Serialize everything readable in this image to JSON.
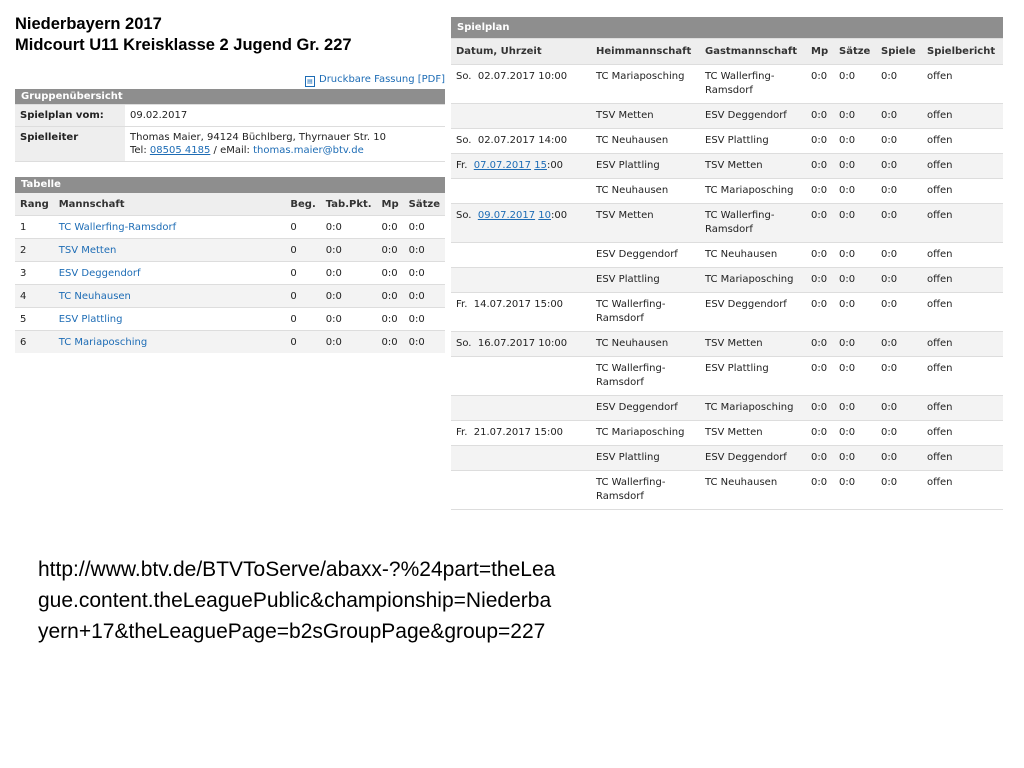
{
  "page": {
    "title_line1": "Niederbayern 2017",
    "title_line2": "Midcourt U11 Kreisklasse 2 Jugend Gr. 227",
    "print_link": "Druckbare Fassung [PDF]"
  },
  "group": {
    "header": "Gruppenübersicht",
    "spielplan_label": "Spielplan vom:",
    "spielplan_value": "09.02.2017",
    "leiter_label": "Spielleiter",
    "leiter_name": "Thomas Maier, 94124 Büchlberg, Thyrnauer Str. 10",
    "tel_label": "Tel: ",
    "tel_value": "08505 4185",
    "email_label": " / eMail: ",
    "email_value": "thomas.maier@btv.de"
  },
  "table": {
    "header": "Tabelle",
    "columns": [
      "Rang",
      "Mannschaft",
      "Beg.",
      "Tab.Pkt.",
      "Mp",
      "Sätze"
    ],
    "rows": [
      {
        "rang": "1",
        "team": "TC Wallerfing-Ramsdorf",
        "beg": "0",
        "pkt": "0:0",
        "mp": "0:0",
        "saetze": "0:0"
      },
      {
        "rang": "2",
        "team": "TSV Metten",
        "beg": "0",
        "pkt": "0:0",
        "mp": "0:0",
        "saetze": "0:0"
      },
      {
        "rang": "3",
        "team": "ESV Deggendorf",
        "beg": "0",
        "pkt": "0:0",
        "mp": "0:0",
        "saetze": "0:0"
      },
      {
        "rang": "4",
        "team": "TC Neuhausen",
        "beg": "0",
        "pkt": "0:0",
        "mp": "0:0",
        "saetze": "0:0"
      },
      {
        "rang": "5",
        "team": "ESV Plattling",
        "beg": "0",
        "pkt": "0:0",
        "mp": "0:0",
        "saetze": "0:0"
      },
      {
        "rang": "6",
        "team": "TC Mariaposching",
        "beg": "0",
        "pkt": "0:0",
        "mp": "0:0",
        "saetze": "0:0"
      }
    ]
  },
  "schedule": {
    "header": "Spielplan",
    "columns": [
      "Datum, Uhrzeit",
      "Heimmannschaft",
      "Gastmannschaft",
      "Mp",
      "Sätze",
      "Spiele",
      "Spielbericht"
    ],
    "rows": [
      {
        "day": "So.",
        "date": "02.07.2017",
        "time_h": "10",
        "time_m": ":00",
        "linked": false,
        "home": "TC Mariaposching",
        "guest": "TC Wallerfing-Ramsdorf",
        "mp": "0:0",
        "saetze": "0:0",
        "spiele": "0:0",
        "bericht": "offen"
      },
      {
        "day": "",
        "date": "",
        "time_h": "",
        "time_m": "",
        "linked": false,
        "home": "TSV Metten",
        "guest": "ESV Deggendorf",
        "mp": "0:0",
        "saetze": "0:0",
        "spiele": "0:0",
        "bericht": "offen"
      },
      {
        "day": "So.",
        "date": "02.07.2017",
        "time_h": "14",
        "time_m": ":00",
        "linked": false,
        "home": "TC Neuhausen",
        "guest": "ESV Plattling",
        "mp": "0:0",
        "saetze": "0:0",
        "spiele": "0:0",
        "bericht": "offen"
      },
      {
        "day": "Fr.",
        "date": "07.07.2017",
        "time_h": "15",
        "time_m": ":00",
        "linked": true,
        "home": "ESV Plattling",
        "guest": "TSV Metten",
        "mp": "0:0",
        "saetze": "0:0",
        "spiele": "0:0",
        "bericht": "offen"
      },
      {
        "day": "",
        "date": "",
        "time_h": "",
        "time_m": "",
        "linked": false,
        "home": "TC Neuhausen",
        "guest": "TC Mariaposching",
        "mp": "0:0",
        "saetze": "0:0",
        "spiele": "0:0",
        "bericht": "offen"
      },
      {
        "day": "So.",
        "date": "09.07.2017",
        "time_h": "10",
        "time_m": ":00",
        "linked": true,
        "home": "TSV Metten",
        "guest": "TC Wallerfing-Ramsdorf",
        "mp": "0:0",
        "saetze": "0:0",
        "spiele": "0:0",
        "bericht": "offen"
      },
      {
        "day": "",
        "date": "",
        "time_h": "",
        "time_m": "",
        "linked": false,
        "home": "ESV Deggendorf",
        "guest": "TC Neuhausen",
        "mp": "0:0",
        "saetze": "0:0",
        "spiele": "0:0",
        "bericht": "offen"
      },
      {
        "day": "",
        "date": "",
        "time_h": "",
        "time_m": "",
        "linked": false,
        "home": "ESV Plattling",
        "guest": "TC Mariaposching",
        "mp": "0:0",
        "saetze": "0:0",
        "spiele": "0:0",
        "bericht": "offen"
      },
      {
        "day": "Fr.",
        "date": "14.07.2017",
        "time_h": "15",
        "time_m": ":00",
        "linked": false,
        "home": "TC Wallerfing-Ramsdorf",
        "guest": "ESV Deggendorf",
        "mp": "0:0",
        "saetze": "0:0",
        "spiele": "0:0",
        "bericht": "offen"
      },
      {
        "day": "So.",
        "date": "16.07.2017",
        "time_h": "10",
        "time_m": ":00",
        "linked": false,
        "home": "TC Neuhausen",
        "guest": "TSV Metten",
        "mp": "0:0",
        "saetze": "0:0",
        "spiele": "0:0",
        "bericht": "offen"
      },
      {
        "day": "",
        "date": "",
        "time_h": "",
        "time_m": "",
        "linked": false,
        "home": "TC Wallerfing-Ramsdorf",
        "guest": "ESV Plattling",
        "mp": "0:0",
        "saetze": "0:0",
        "spiele": "0:0",
        "bericht": "offen"
      },
      {
        "day": "",
        "date": "",
        "time_h": "",
        "time_m": "",
        "linked": false,
        "home": "ESV Deggendorf",
        "guest": "TC Mariaposching",
        "mp": "0:0",
        "saetze": "0:0",
        "spiele": "0:0",
        "bericht": "offen"
      },
      {
        "day": "Fr.",
        "date": "21.07.2017",
        "time_h": "15",
        "time_m": ":00",
        "linked": false,
        "home": "TC Mariaposching",
        "guest": "TSV Metten",
        "mp": "0:0",
        "saetze": "0:0",
        "spiele": "0:0",
        "bericht": "offen"
      },
      {
        "day": "",
        "date": "",
        "time_h": "",
        "time_m": "",
        "linked": false,
        "home": "ESV Plattling",
        "guest": "ESV Deggendorf",
        "mp": "0:0",
        "saetze": "0:0",
        "spiele": "0:0",
        "bericht": "offen"
      },
      {
        "day": "",
        "date": "",
        "time_h": "",
        "time_m": "",
        "linked": false,
        "home": "TC Wallerfing-Ramsdorf",
        "guest": "TC Neuhausen",
        "mp": "0:0",
        "saetze": "0:0",
        "spiele": "0:0",
        "bericht": "offen"
      }
    ]
  },
  "caption": {
    "url": "http://www.btv.de/BTVToServe/abaxx-?%24part=theLeague.content.theLeaguePublic&championship=Niederbayern+17&theLeaguePage=b2sGroupPage&group=227"
  }
}
